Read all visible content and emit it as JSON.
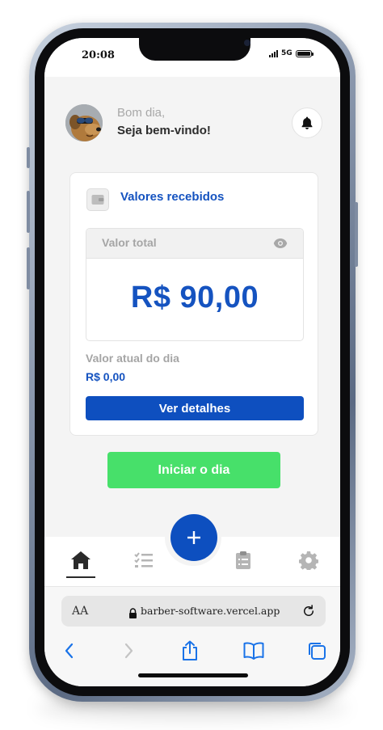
{
  "status_bar": {
    "time": "20:08",
    "network": "5G"
  },
  "header": {
    "greeting": "Bom dia,",
    "welcome": "Seja bem-vindo!"
  },
  "card": {
    "title": "Valores recebidos",
    "total_label": "Valor total",
    "total_value": "R$ 90,00",
    "day_label": "Valor atual do dia",
    "day_value": "R$ 0,00",
    "details_button": "Ver detalhes"
  },
  "start_button": "Iniciar o dia",
  "fab": {
    "label": "+"
  },
  "tabs": [
    {
      "icon": "home-icon",
      "active": true
    },
    {
      "icon": "checklist-icon",
      "active": false
    },
    {
      "icon": "clipboard-icon",
      "active": false
    },
    {
      "icon": "gear-icon",
      "active": false
    }
  ],
  "browser": {
    "aa_label": "AA",
    "url": "barber-software.vercel.app"
  },
  "colors": {
    "primary": "#0e4fbf",
    "accent_green": "#47e06a",
    "screen_bg": "#f4f4f4"
  }
}
